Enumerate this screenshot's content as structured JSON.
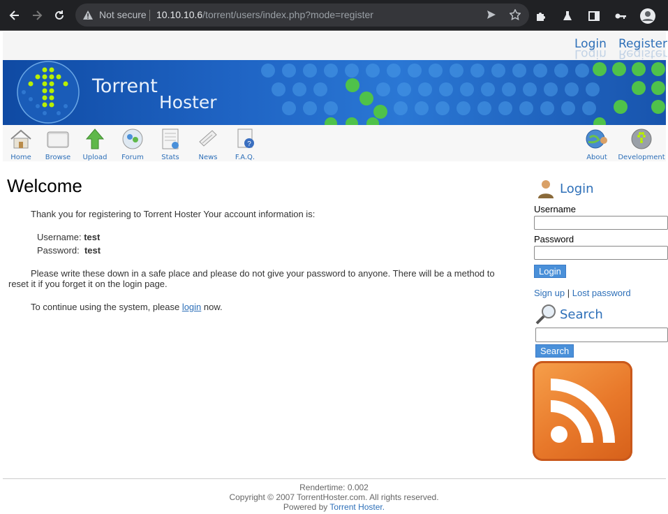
{
  "browser": {
    "security_label": "Not secure",
    "url_host": "10.10.10.6",
    "url_path": "/torrent/users/index.php?mode=register"
  },
  "header": {
    "login_link": "Login",
    "register_link": "Register"
  },
  "banner": {
    "title_line1": "Torrent",
    "title_line2": "Hoster"
  },
  "nav": {
    "items": [
      {
        "label": "Home",
        "icon": "house-icon"
      },
      {
        "label": "Browse",
        "icon": "folder-icon"
      },
      {
        "label": "Upload",
        "icon": "upload-arrow-icon"
      },
      {
        "label": "Forum",
        "icon": "forum-icon"
      },
      {
        "label": "Stats",
        "icon": "stats-icon"
      },
      {
        "label": "News",
        "icon": "news-icon"
      },
      {
        "label": "F.A.Q.",
        "icon": "faq-icon"
      },
      {
        "label": "About",
        "icon": "about-icon"
      },
      {
        "label": "Development",
        "icon": "development-icon"
      }
    ]
  },
  "main": {
    "title": "Welcome",
    "intro": "Thank you for registering to Torrent Hoster Your account information is:",
    "username_label": "Username:",
    "username_value": "test",
    "password_label": "Password:",
    "password_value": "test",
    "warning": "Please write these down in a safe place and please do not give your password to anyone. There will be a method to reset it if you forget it on the login page.",
    "continue_prefix": "To continue using the system, please",
    "continue_link": "login",
    "continue_suffix": "now."
  },
  "sidebar": {
    "login_heading": "Login",
    "username_label": "Username",
    "password_label": "Password",
    "login_button": "Login",
    "signup_link": "Sign up",
    "separator": "|",
    "lost_password_link": "Lost password",
    "search_heading": "Search",
    "search_button": "Search"
  },
  "footer": {
    "rendertime": "Rendertime: 0.002",
    "copyright": "Copyright © 2007 TorrentHoster.com. All rights reserved.",
    "powered_prefix": "Powered by",
    "powered_link": "Torrent Hoster."
  },
  "colors": {
    "link": "#2d6fb8",
    "banner": "#1f64c4",
    "rss": "#e8782a"
  }
}
